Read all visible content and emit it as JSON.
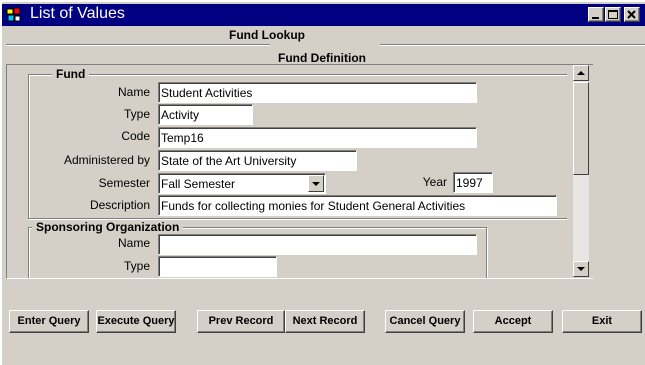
{
  "window": {
    "title": "List of Values"
  },
  "form": {
    "title": "Fund Lookup",
    "section_title": "Fund Definition"
  },
  "fund": {
    "group_label": "Fund",
    "name_label": "Name",
    "name_value": "Student Activities",
    "type_label": "Type",
    "type_value": "Activity",
    "code_label": "Code",
    "code_value": "Temp16",
    "administered_label": "Administered by",
    "administered_value": "State of the Art University",
    "semester_label": "Semester",
    "semester_value": "Fall Semester",
    "year_label": "Year",
    "year_value": "1997",
    "description_label": "Description",
    "description_value": "Funds for collecting monies for Student General Activities"
  },
  "sponsor": {
    "group_label": "Sponsoring Organization",
    "name_label": "Name",
    "name_value": "",
    "type_label": "Type",
    "type_value": ""
  },
  "buttons": {
    "enter_query": "Enter Query",
    "execute_query": "Execute Query",
    "prev_record": "Prev Record",
    "next_record": "Next Record",
    "cancel_query": "Cancel Query",
    "accept": "Accept",
    "exit": "Exit"
  },
  "colors": {
    "titlebar": "#000080",
    "face": "#d4d0c8"
  }
}
